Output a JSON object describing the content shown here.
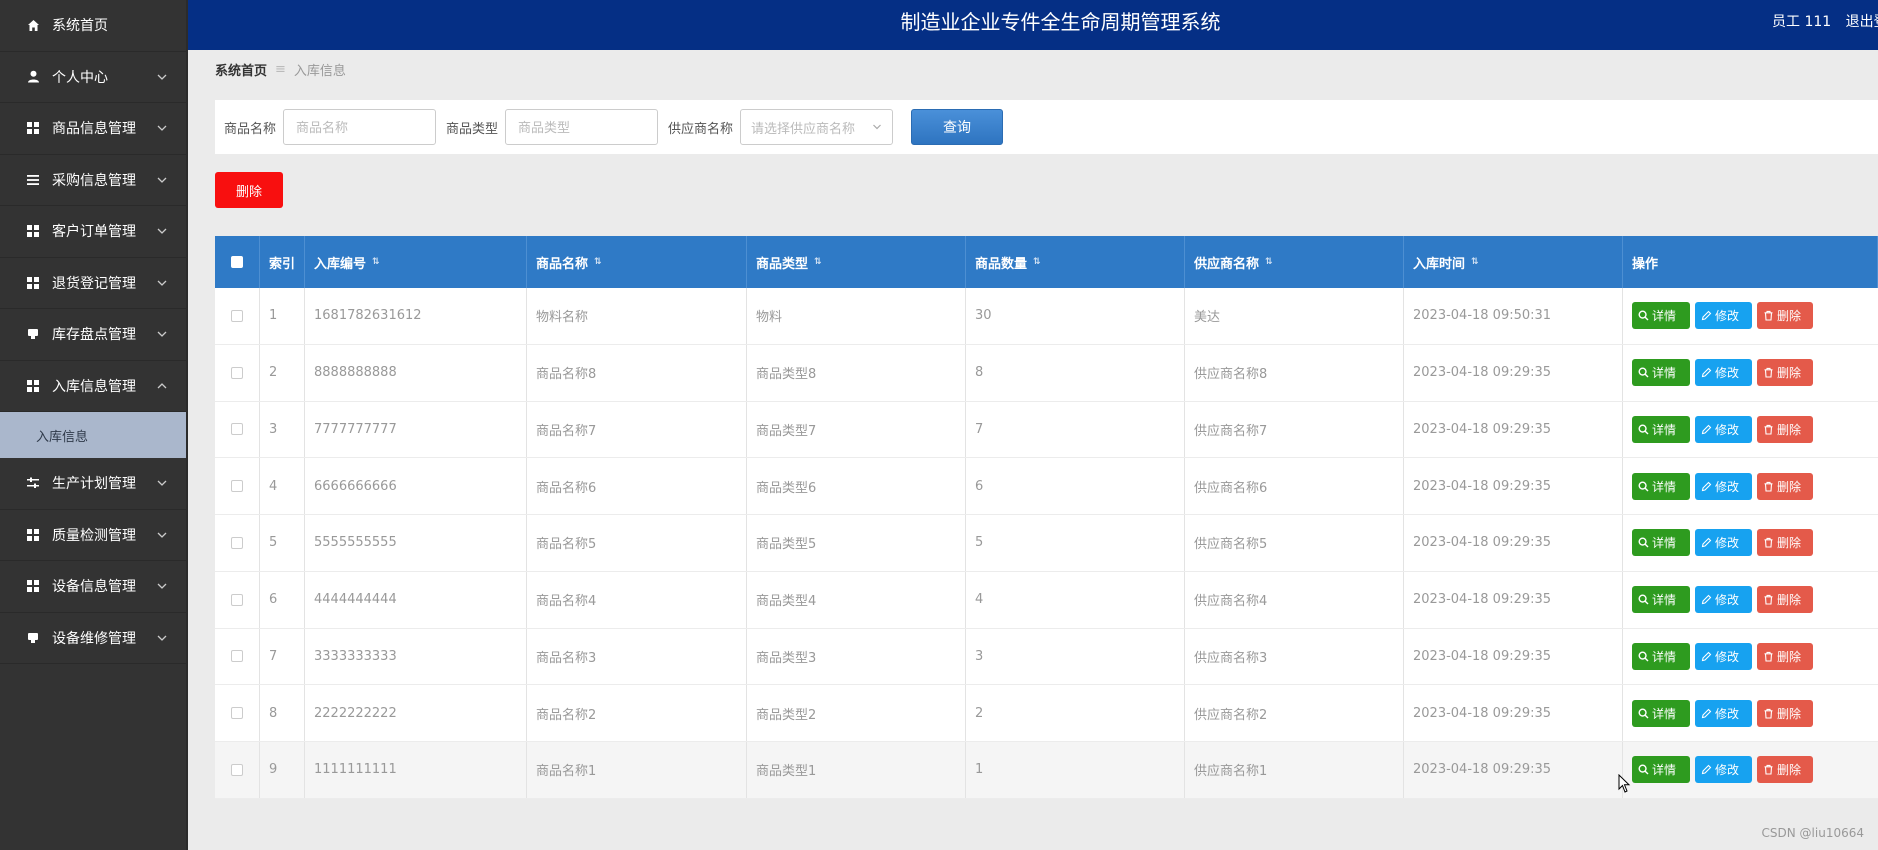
{
  "sidebar": {
    "items": [
      {
        "label": "系统首页",
        "icon": "home-icon",
        "expandable": false
      },
      {
        "label": "个人中心",
        "icon": "user-icon",
        "expandable": true
      },
      {
        "label": "商品信息管理",
        "icon": "grid-icon",
        "expandable": true
      },
      {
        "label": "采购信息管理",
        "icon": "list-icon",
        "expandable": true
      },
      {
        "label": "客户订单管理",
        "icon": "grid-icon",
        "expandable": true
      },
      {
        "label": "退货登记管理",
        "icon": "grid-icon",
        "expandable": true
      },
      {
        "label": "库存盘点管理",
        "icon": "stamp-icon",
        "expandable": true
      },
      {
        "label": "入库信息管理",
        "icon": "grid-icon",
        "expandable": true,
        "open": true
      },
      {
        "label": "生产计划管理",
        "icon": "sliders-icon",
        "expandable": true
      },
      {
        "label": "质量检测管理",
        "icon": "grid-icon",
        "expandable": true
      },
      {
        "label": "设备信息管理",
        "icon": "grid-icon",
        "expandable": true
      },
      {
        "label": "设备维修管理",
        "icon": "stamp-icon",
        "expandable": true
      }
    ],
    "submenu_active": "入库信息"
  },
  "header": {
    "title": "制造业企业专件全生命周期管理系统",
    "user": "员工 111",
    "logout": "退出登"
  },
  "breadcrumb": {
    "home": "系统首页",
    "separator": "≡",
    "current": "入库信息"
  },
  "search": {
    "name_label": "商品名称",
    "name_placeholder": "商品名称",
    "type_label": "商品类型",
    "type_placeholder": "商品类型",
    "supplier_label": "供应商名称",
    "supplier_placeholder": "请选择供应商名称",
    "query_button": "查询"
  },
  "actions": {
    "delete_button": "删除"
  },
  "table": {
    "columns": [
      "索引",
      "入库编号",
      "商品名称",
      "商品类型",
      "商品数量",
      "供应商名称",
      "入库时间",
      "操作"
    ],
    "rows": [
      [
        "1",
        "1681782631612",
        "物料名称",
        "物料",
        "30",
        "美达",
        "2023-04-18 09:50:31"
      ],
      [
        "2",
        "8888888888",
        "商品名称8",
        "商品类型8",
        "8",
        "供应商名称8",
        "2023-04-18 09:29:35"
      ],
      [
        "3",
        "7777777777",
        "商品名称7",
        "商品类型7",
        "7",
        "供应商名称7",
        "2023-04-18 09:29:35"
      ],
      [
        "4",
        "6666666666",
        "商品名称6",
        "商品类型6",
        "6",
        "供应商名称6",
        "2023-04-18 09:29:35"
      ],
      [
        "5",
        "5555555555",
        "商品名称5",
        "商品类型5",
        "5",
        "供应商名称5",
        "2023-04-18 09:29:35"
      ],
      [
        "6",
        "4444444444",
        "商品名称4",
        "商品类型4",
        "4",
        "供应商名称4",
        "2023-04-18 09:29:35"
      ],
      [
        "7",
        "3333333333",
        "商品名称3",
        "商品类型3",
        "3",
        "供应商名称3",
        "2023-04-18 09:29:35"
      ],
      [
        "8",
        "2222222222",
        "商品名称2",
        "商品类型2",
        "2",
        "供应商名称2",
        "2023-04-18 09:29:35"
      ],
      [
        "9",
        "1111111111",
        "商品名称1",
        "商品类型1",
        "1",
        "供应商名称1",
        "2023-04-18 09:29:35"
      ]
    ],
    "op_labels": {
      "detail": "详情",
      "edit": "修改",
      "delete": "删除"
    }
  },
  "colors": {
    "header_bg": "#052f85",
    "sidebar_bg": "#333333",
    "table_header_bg": "#2f7ac6",
    "detail_btn": "#2e9b1f",
    "edit_btn": "#17a2f0",
    "delete_btn": "#e45a4a",
    "batch_delete_btn": "#f80f0f"
  },
  "watermark": "CSDN @liu10664"
}
